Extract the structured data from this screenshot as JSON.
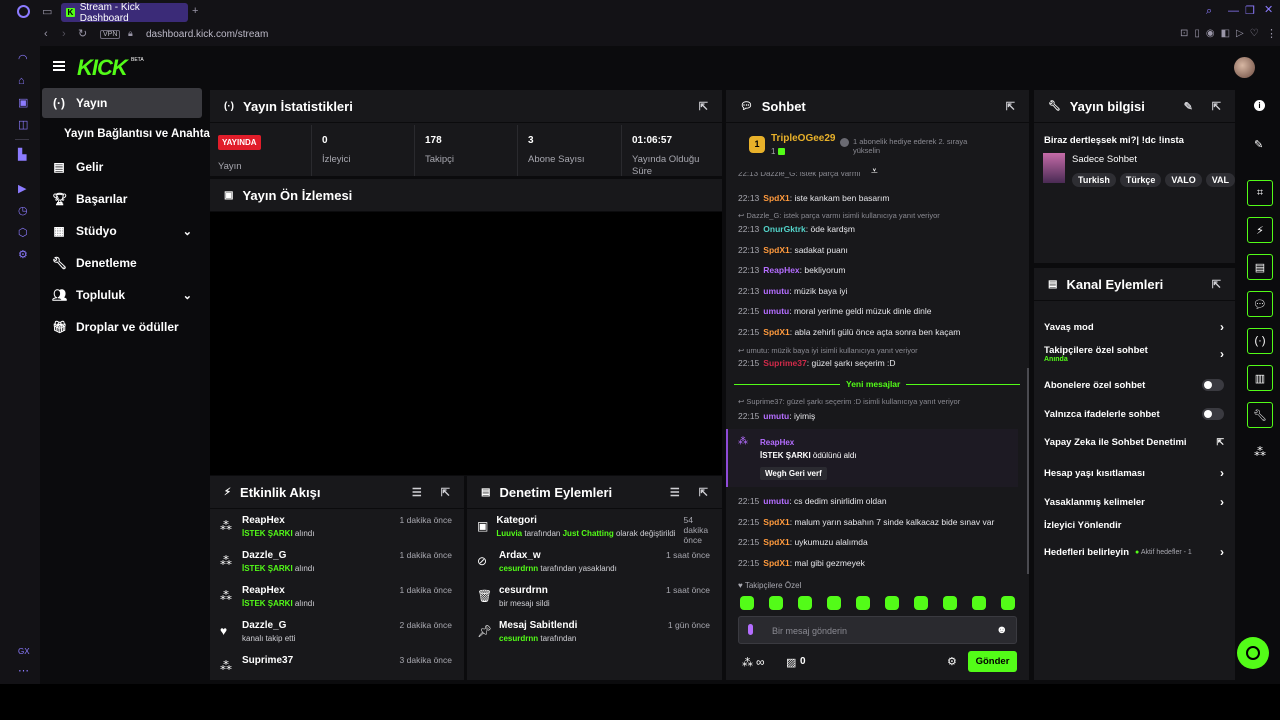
{
  "browser": {
    "tab_title": "Stream - Kick Dashboard",
    "address": "dashboard.kick.com/stream",
    "vpn": "VPN",
    "gx": "GX"
  },
  "logo": "KICK",
  "logo_beta": "BETA",
  "nav": {
    "stream": "Yayın",
    "connection": "Yayın Bağlantısı ve Anahtarı",
    "income": "Gelir",
    "achievements": "Başarılar",
    "studio": "Stüdyo",
    "moderation": "Denetleme",
    "community": "Topluluk",
    "drops": "Droplar ve ödüller"
  },
  "stats": {
    "title": "Yayın İstatistikleri",
    "live_badge": "YAYINDA",
    "items": [
      {
        "value": "",
        "label": "Yayın"
      },
      {
        "value": "0",
        "label": "İzleyici"
      },
      {
        "value": "178",
        "label": "Takipçi"
      },
      {
        "value": "3",
        "label": "Abone Sayısı"
      },
      {
        "value": "01:06:57",
        "label": "Yayında Olduğu Süre"
      }
    ]
  },
  "preview": {
    "title": "Yayın Ön İzlemesi"
  },
  "activity": {
    "title": "Etkinlik Akışı",
    "items": [
      {
        "user": "ReapHex",
        "accent": "İSTEK ŞARKI",
        "rest": " alındı",
        "time": "1 dakika önce"
      },
      {
        "user": "Dazzle_G",
        "accent": "İSTEK ŞARKI",
        "rest": " alındı",
        "time": "1 dakika önce"
      },
      {
        "user": "ReapHex",
        "accent": "İSTEK ŞARKI",
        "rest": " alındı",
        "time": "1 dakika önce"
      },
      {
        "user": "Dazzle_G",
        "accent": "",
        "rest": "kanalı takip etti",
        "time": "2 dakika önce"
      },
      {
        "user": "Suprime37",
        "accent": "",
        "rest": "",
        "time": "3 dakika önce"
      }
    ]
  },
  "modactions": {
    "title": "Denetim Eylemleri",
    "items": [
      {
        "title": "Kategori",
        "a": "Luuvia",
        "b": " tarafından ",
        "c": "Just Chatting",
        "d": " olarak değiştirildi",
        "time": "54 dakika önce"
      },
      {
        "title": "Ardax_w",
        "a": "cesurdrnn",
        "b": " tarafından yasaklandı",
        "c": "",
        "d": "",
        "time": "1 saat önce"
      },
      {
        "title": "cesurdrnn",
        "a": "",
        "b": "bir mesajı sildi",
        "c": "",
        "d": "",
        "time": "1 saat önce"
      },
      {
        "title": "Mesaj Sabitlendi",
        "a": "cesurdrnn",
        "b": " tarafından",
        "c": "",
        "d": "",
        "time": "1 gün önce"
      }
    ]
  },
  "chat": {
    "title": "Sohbet",
    "pinned_user": "TripleOGee29",
    "pinned_count": "1",
    "pinned_text": "1 abonelik hediye ederek 2. sıraya yükselin",
    "top_partial": "22:13  Dazzle_G: istek parça varmı",
    "new_messages": "Yeni mesajlar",
    "followers_only": "Takipçilere Özel",
    "input_placeholder": "Bir mesaj gönderin",
    "send": "Gönder",
    "infinity": "∞",
    "gift_count": "0",
    "reward_user": "ReapHex",
    "reward_title": "İSTEK ŞARKI",
    "reward_rest": " ödülünü aldı",
    "reward_value": "Wegh Geri verf"
  },
  "chat_lines": [
    {
      "time": "22:13",
      "user": "SpdX1",
      "color": "#ff9a3d",
      "msg": ": iste kankam ben basarım"
    },
    {
      "reply": "Dazzle_G: istek parça varmı isimli kullanıcıya yanıt veriyor"
    },
    {
      "time": "22:13",
      "user": "OnurGktrk",
      "color": "#53d3c9",
      "msg": ": öde kardşm"
    },
    {
      "time": "22:13",
      "user": "SpdX1",
      "color": "#ff9a3d",
      "msg": ": sadakat puanı"
    },
    {
      "time": "22:13",
      "user": "ReapHex",
      "color": "#b46dff",
      "msg": ": bekliyorum"
    },
    {
      "time": "22:13",
      "user": "umutu",
      "color": "#b46dff",
      "msg": ": müzik baya iyi"
    },
    {
      "time": "22:15",
      "user": "umutu",
      "color": "#b46dff",
      "msg": ": moral yerime geldi müzuk dinle dinle"
    },
    {
      "time": "22:15",
      "user": "SpdX1",
      "color": "#ff9a3d",
      "msg": ": abla zehirli gülü önce açta sonra ben kaçam"
    },
    {
      "reply": "umutu: müzik baya iyi isimli kullanıcıya yanıt veriyor"
    },
    {
      "time": "22:15",
      "user": "Suprime37",
      "color": "#d22a4a",
      "msg": ": güzel şarkı seçerim :D"
    },
    {
      "reply": "Suprime37: güzel şarkı seçerim :D isimli kullanıcıya yanıt veriyor"
    },
    {
      "time": "22:15",
      "user": "umutu",
      "color": "#b46dff",
      "msg": ": iyimiş"
    },
    {
      "time": "22:15",
      "user": "umutu",
      "color": "#b46dff",
      "msg": ": cs dedim sinirlidim oldan"
    },
    {
      "time": "22:15",
      "user": "SpdX1",
      "color": "#ff9a3d",
      "msg": ": malum yarın sabahın 7 sinde kalkacaz bide sınav var"
    },
    {
      "time": "22:15",
      "user": "SpdX1",
      "color": "#ff9a3d",
      "msg": ": uykumuzu alalımda"
    },
    {
      "time": "22:15",
      "user": "SpdX1",
      "color": "#ff9a3d",
      "msg": ": mal gibi gezmeyek"
    }
  ],
  "info": {
    "title": "Yayın bilgisi",
    "stream_title": "Biraz dertleşsek mi?| !dc !insta",
    "category": "Sadece Sohbet",
    "tags": [
      "Turkish",
      "Türkçe",
      "VALO",
      "VAL"
    ]
  },
  "channel_actions": {
    "title": "Kanal Eylemleri",
    "slow": "Yavaş mod",
    "followers": "Takipçilere özel sohbet",
    "followers_sub": "Anında",
    "subs": "Abonelere özel sohbet",
    "emotes": "Yalnızca ifadelerle sohbet",
    "ai": "Yapay Zeka ile Sohbet Denetimi",
    "age": "Hesap yaşı kısıtlaması",
    "banned": "Yasaklanmış kelimeler",
    "redirect": "İzleyici Yönlendir",
    "goals": "Hedefleri belirleyin",
    "goals_sub": "Aktif hedefler - 1"
  },
  "colors": {
    "accent": "#53fc18",
    "panel": "#18181b",
    "bg": "#0b0b0d",
    "live": "#e11d2a"
  }
}
